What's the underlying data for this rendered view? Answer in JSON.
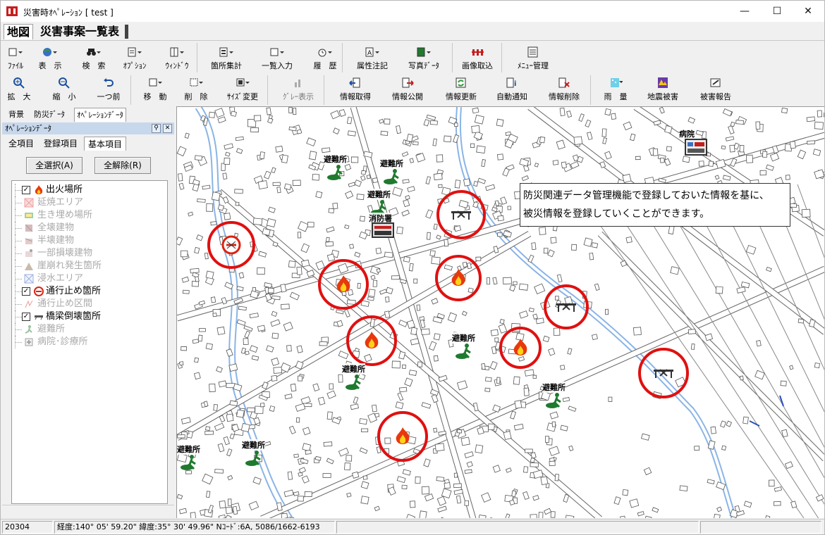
{
  "window": {
    "title": "災害時ｵﾍﾟﾚｰｼｮﾝ [ test ]",
    "minimize": "—",
    "maximize": "☐",
    "close": "✕"
  },
  "main_tabs": [
    {
      "label": "地図"
    },
    {
      "label": "災害事案一覧表"
    }
  ],
  "toolbar1": [
    {
      "label": "ﾌｧｲﾙ",
      "icon": "file-icon"
    },
    {
      "label": "表　示",
      "icon": "globe-icon"
    },
    {
      "label": "検　索",
      "icon": "binoculars-icon"
    },
    {
      "label": "ｵﾌﾟｼｮﾝ",
      "icon": "option-icon"
    },
    {
      "label": "ｳｨﾝﾄﾞｳ",
      "icon": "window-icon"
    },
    {
      "label": "箇所集計",
      "icon": "tally-icon"
    },
    {
      "label": "一覧入力",
      "icon": "list-input-icon"
    },
    {
      "label": "履　歴",
      "icon": "history-icon"
    },
    {
      "label": "属性注記",
      "icon": "annotation-icon"
    },
    {
      "label": "写真ﾃﾞｰﾀ",
      "icon": "photo-icon"
    },
    {
      "label": "画像取込",
      "icon": "image-import-icon"
    },
    {
      "label": "ﾒﾆｭｰ管理",
      "icon": "menu-manage-icon"
    }
  ],
  "toolbar2": [
    {
      "label": "拡　大",
      "icon": "zoom-in-icon"
    },
    {
      "label": "縮　小",
      "icon": "zoom-out-icon"
    },
    {
      "label": "一つ前",
      "icon": "undo-icon"
    },
    {
      "label": "移　動",
      "icon": "move-icon"
    },
    {
      "label": "削　除",
      "icon": "delete-icon"
    },
    {
      "label": "ｻｲｽﾞ変更",
      "icon": "resize-icon"
    },
    {
      "label": "ｸﾞﾚｰ表示",
      "icon": "gray-display-icon"
    },
    {
      "label": "情報取得",
      "icon": "info-get-icon"
    },
    {
      "label": "情報公開",
      "icon": "info-publish-icon"
    },
    {
      "label": "情報更新",
      "icon": "info-update-icon"
    },
    {
      "label": "自動通知",
      "icon": "auto-notify-icon"
    },
    {
      "label": "情報削除",
      "icon": "info-delete-icon"
    },
    {
      "label": "雨　量",
      "icon": "rainfall-icon"
    },
    {
      "label": "地震被害",
      "icon": "earthquake-icon"
    },
    {
      "label": "被害報告",
      "icon": "damage-report-icon"
    }
  ],
  "left_panel": {
    "tabs": [
      "背景",
      "防災ﾃﾞｰﾀ",
      "ｵﾍﾟﾚｰｼｮﾝﾃﾞｰﾀ"
    ],
    "header": "ｵﾍﾟﾚｰｼｮﾝﾃﾞｰﾀ",
    "sub_tabs": [
      "全項目",
      "登録項目",
      "基本項目"
    ],
    "select_all": "全選択(A)",
    "deselect_all": "全解除(R)",
    "layers": [
      {
        "label": "出火場所",
        "checked": true,
        "enabled": true,
        "icon": "fire-icon"
      },
      {
        "label": "延焼エリア",
        "checked": false,
        "enabled": false,
        "icon": "spread-area-icon"
      },
      {
        "label": "生き埋め場所",
        "checked": false,
        "enabled": false,
        "icon": "buried-icon"
      },
      {
        "label": "全壊建物",
        "checked": false,
        "enabled": false,
        "icon": "collapsed-building-icon"
      },
      {
        "label": "半壊建物",
        "checked": false,
        "enabled": false,
        "icon": "half-collapsed-icon"
      },
      {
        "label": "一部損壊建物",
        "checked": false,
        "enabled": false,
        "icon": "partial-damage-icon"
      },
      {
        "label": "崖崩れ発生箇所",
        "checked": false,
        "enabled": false,
        "icon": "landslide-icon"
      },
      {
        "label": "浸水エリア",
        "checked": false,
        "enabled": false,
        "icon": "flood-area-icon"
      },
      {
        "label": "通行止め箇所",
        "checked": true,
        "enabled": true,
        "icon": "road-closed-icon"
      },
      {
        "label": "通行止め区間",
        "checked": false,
        "enabled": false,
        "icon": "closed-section-icon"
      },
      {
        "label": "橋梁倒壊箇所",
        "checked": true,
        "enabled": true,
        "icon": "bridge-collapse-icon"
      },
      {
        "label": "避難所",
        "checked": false,
        "enabled": false,
        "icon": "shelter-icon"
      },
      {
        "label": "病院･診療所",
        "checked": false,
        "enabled": false,
        "icon": "hospital-icon"
      }
    ]
  },
  "map": {
    "callout": [
      "防災関連データ管理機能で登録しておいた情報を基に、",
      "被災情報を登録していくことができます。"
    ],
    "shelter_label": "避難所",
    "fire_station_label": "消防署",
    "hospital_label": "病院",
    "ring_color": "#e01010"
  },
  "status": {
    "code": "20304",
    "coords": "経度:140° 05' 59.20\"  緯度:35° 30' 49.96\"  Nｺｰﾄﾞ:6A, 5086/1662-6193"
  }
}
